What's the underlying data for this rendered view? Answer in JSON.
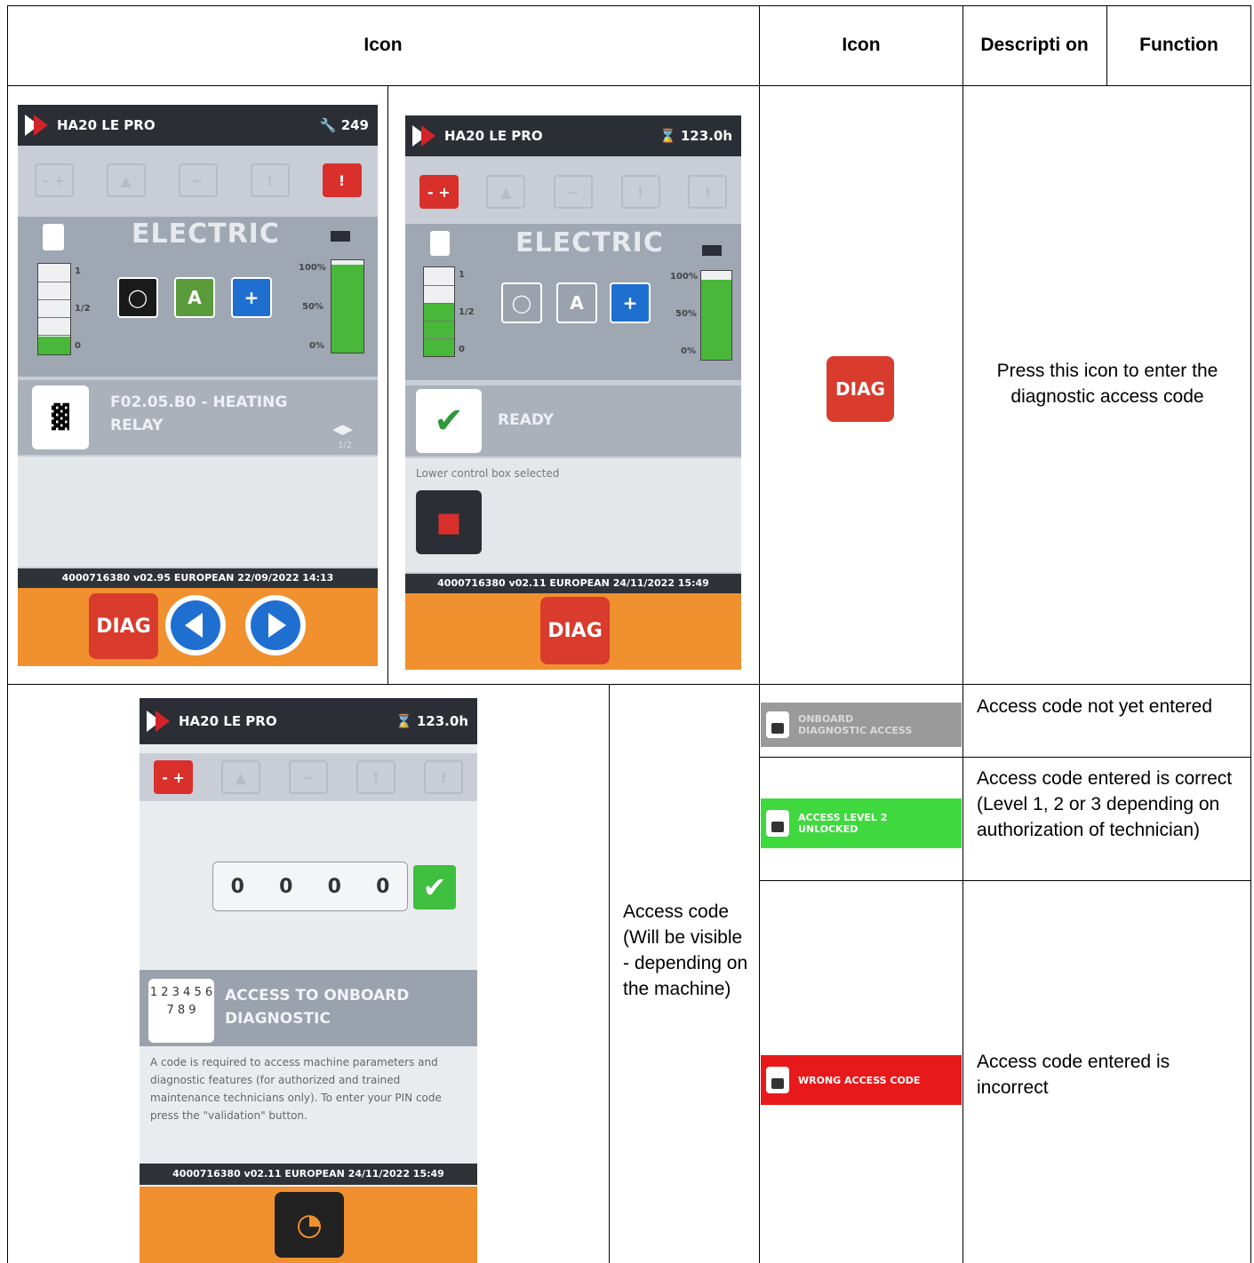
{
  "headers": {
    "icon_left": "Icon",
    "icon": "Icon",
    "description": "Descripti on",
    "function": "Function"
  },
  "row1": {
    "diag_icon_label": "DIAG",
    "function_text": "Press this icon to enter the diagnostic access code",
    "screen_a": {
      "model": "HA20 LE PRO",
      "counter": "249",
      "mode": "ELECTRIC",
      "fuel_labels": [
        "1",
        "1/2",
        "0"
      ],
      "battery_labels": [
        "100%",
        "50%",
        "0%"
      ],
      "fuel_level": 0.2,
      "battery_level": 0.95,
      "fault_text": "F02.05.B0 - HEATING RELAY",
      "page": "1/2",
      "footer": "4000716380  v02.95  EUROPEAN  22/09/2022 14:13",
      "diag_button": "DIAG"
    },
    "screen_b": {
      "model": "HA20 LE PRO",
      "hours": "123.0h",
      "mode": "ELECTRIC",
      "fuel_labels": [
        "1",
        "1/2",
        "0"
      ],
      "battery_labels": [
        "100%",
        "50%",
        "0%"
      ],
      "fuel_level": 0.6,
      "battery_level": 0.9,
      "status": "READY",
      "info": "Lower control box selected",
      "footer": "4000716380  v02.11  EUROPEAN  24/11/2022 15:49",
      "diag_button": "DIAG"
    }
  },
  "row2": {
    "description": "Access code (Will be visible - depending on the machine)",
    "screen_c": {
      "model": "HA20 LE PRO",
      "hours": "123.0h",
      "code_digits": [
        "0",
        "0",
        "0",
        "0"
      ],
      "access_title": "ACCESS TO ONBOARD DIAGNOSTIC",
      "keypad": "1 2 3 4 5 6 7 8 9",
      "body_text": "A code is required to access machine parameters and diagnostic features (for authorized and trained maintenance technicians only). To enter your PIN code press the \"validation\" button.",
      "footer": "4000716380  v02.11  EUROPEAN  24/11/2022 15:49"
    },
    "states": [
      {
        "badge": "ONBOARD DIAGNOSTIC ACCESS",
        "color": "#9a9a9a",
        "function": "Access code not yet entered"
      },
      {
        "badge": "ACCESS LEVEL 2 UNLOCKED",
        "color": "#3fd83f",
        "function": "Access code entered is correct (Level  1,  2 or  3 depending on authorization of technician)"
      },
      {
        "badge": "WRONG ACCESS CODE",
        "color": "#e8191a",
        "function": "Access code entered is incorrect"
      }
    ]
  }
}
